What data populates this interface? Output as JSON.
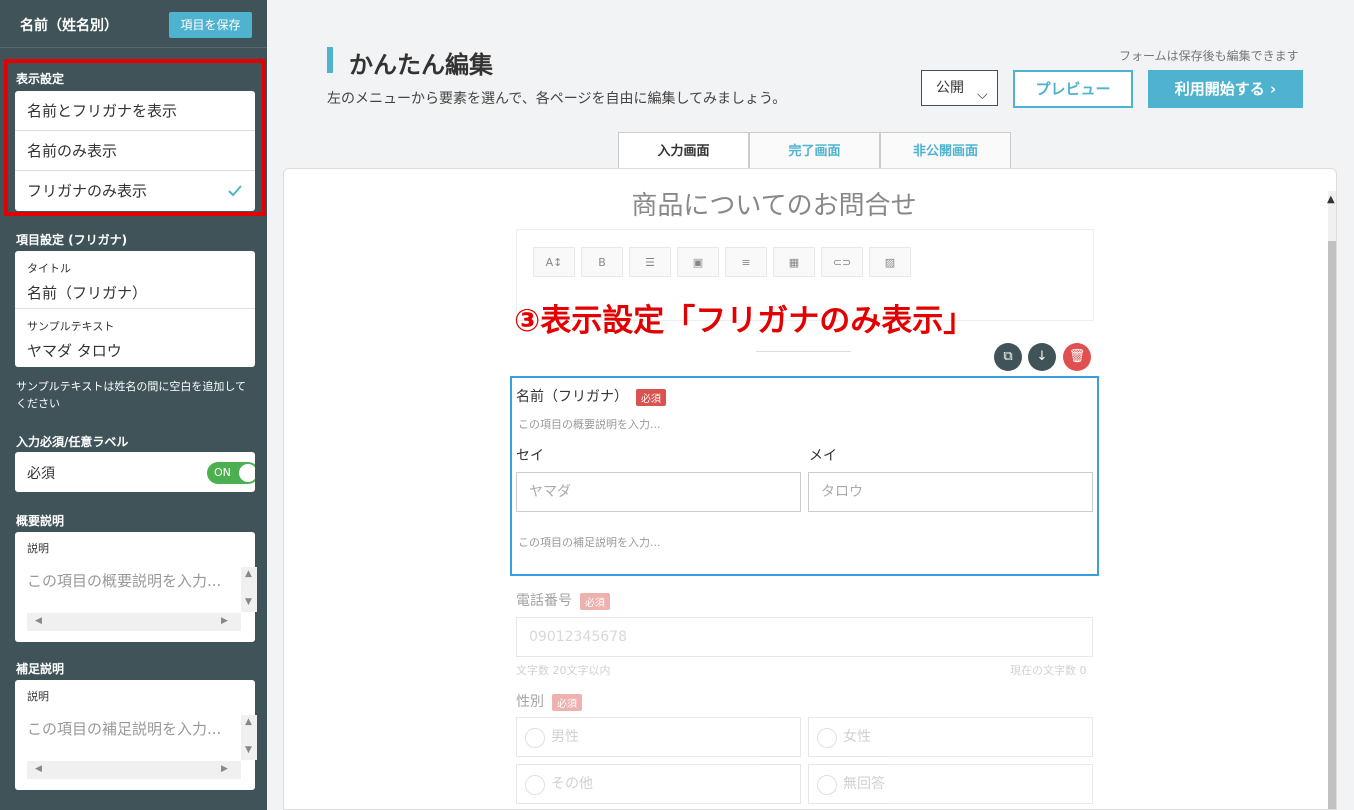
{
  "sidebar": {
    "title": "名前（姓名別）",
    "save_button": "項目を保存",
    "display_settings": {
      "label": "表示設定",
      "options": [
        "名前とフリガナを表示",
        "名前のみ表示",
        "フリガナのみ表示"
      ],
      "selected": "フリガナのみ表示"
    },
    "item_settings": {
      "label": "項目設定 (フリガナ)",
      "title_label": "タイトル",
      "title_value": "名前（フリガナ）",
      "sample_label": "サンプルテキスト",
      "sample_value": "ヤマダ タロウ"
    },
    "sample_note": "サンプルテキストは姓名の間に空白を追加してください",
    "required_section": {
      "label": "入力必須/任意ラベル",
      "value": "必須",
      "toggle": "ON"
    },
    "summary": {
      "label": "概要説明",
      "field_label": "説明",
      "placeholder": "この項目の概要説明を入力..."
    },
    "supplement": {
      "label": "補足説明",
      "field_label": "説明",
      "placeholder": "この項目の補足説明を入力..."
    }
  },
  "main": {
    "title": "かんたん編集",
    "subtitle": "左のメニューから要素を選んで、各ページを自由に編集してみましょう。",
    "saved_note": "フォームは保存後も編集できます",
    "publish_select": "公開",
    "preview_button": "プレビュー",
    "start_button": "利用開始する ›",
    "tabs": [
      "入力画面",
      "完了画面",
      "非公開画面"
    ],
    "active_tab": "入力画面"
  },
  "form": {
    "title": "商品についてのお問合せ",
    "annotation": "③表示設定「フリガナのみ表示」",
    "selected_field": {
      "label": "名前（フリガナ）",
      "required_badge": "必須",
      "summary_placeholder": "この項目の概要説明を入力...",
      "sei_label": "セイ",
      "mei_label": "メイ",
      "sei_placeholder": "ヤマダ",
      "mei_placeholder": "タロウ",
      "supplement_placeholder": "この項目の補足説明を入力..."
    },
    "phone": {
      "label": "電話番号",
      "required_badge": "必須",
      "placeholder": "09012345678",
      "limit_note": "文字数 20文字以内",
      "count_note": "現在の文字数 0"
    },
    "gender": {
      "label": "性別",
      "required_badge": "必須",
      "options": [
        "男性",
        "女性",
        "その他",
        "無回答"
      ]
    }
  }
}
